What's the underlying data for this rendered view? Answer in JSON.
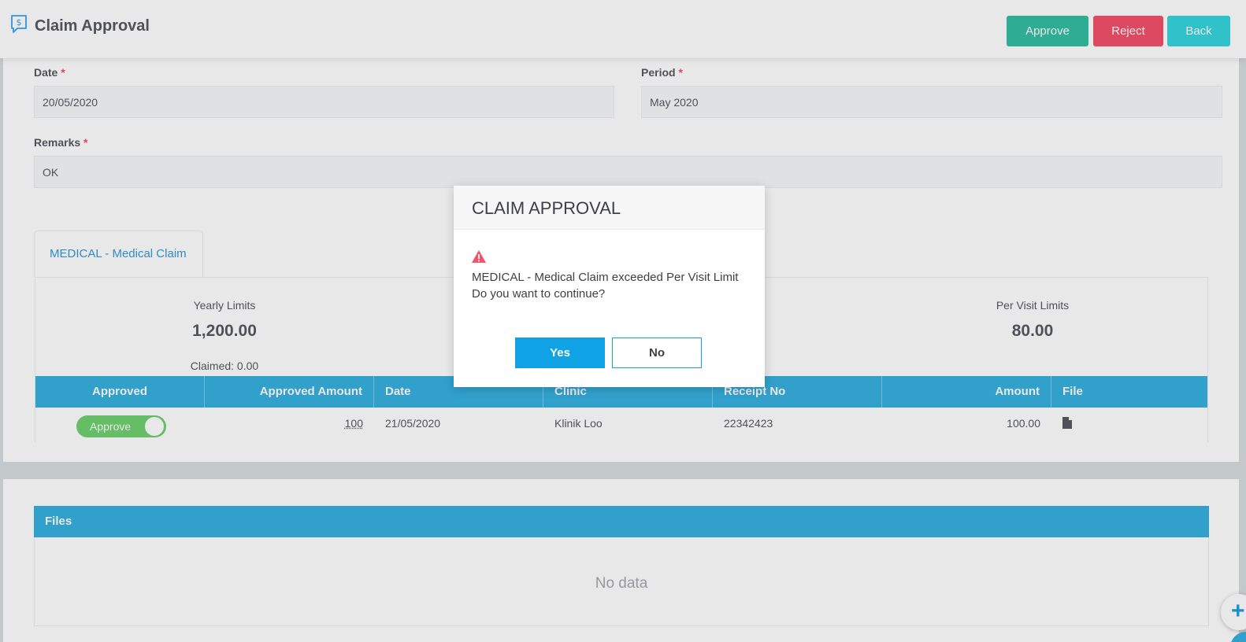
{
  "header": {
    "title": "Claim Approval",
    "approve_label": "Approve",
    "reject_label": "Reject",
    "back_label": "Back",
    "icon": "claim-dollar-icon"
  },
  "form": {
    "date_label": "Date",
    "date_value": "20/05/2020",
    "period_label": "Period",
    "period_value": "May 2020",
    "remarks_label": "Remarks",
    "remarks_value": "OK",
    "required_mark": "*"
  },
  "tab": {
    "label": "MEDICAL - Medical Claim"
  },
  "limits": {
    "yearly_label": "Yearly Limits",
    "yearly_value": "1,200.00",
    "claimed_text": "Claimed: 0.00",
    "per_visit_label": "Per Visit Limits",
    "per_visit_value": "80.00"
  },
  "table": {
    "columns": [
      "Approved",
      "Approved Amount",
      "Date",
      "Clinic",
      "Receipt No",
      "Amount",
      "File"
    ],
    "rows": [
      {
        "approved": "Approve",
        "approved_amount": "100",
        "date": "21/05/2020",
        "clinic": "Klinik Loo",
        "receipt_no": "22342423",
        "amount": "100.00",
        "file_icon": "file-icon"
      }
    ]
  },
  "files": {
    "title": "Files",
    "empty_text": "No data"
  },
  "modal": {
    "title": "CLAIM APPROVAL",
    "icon": "warning-icon",
    "message_line1": "MEDICAL - Medical Claim exceeded Per Visit Limit",
    "message_line2": "Do you want to continue?",
    "yes_label": "Yes",
    "no_label": "No"
  },
  "fab": {
    "label": "+"
  },
  "colors": {
    "approve": "#34bfa3",
    "reject": "#f4516c",
    "back": "#36d6dd",
    "table_header": "#36b0e0",
    "modal_yes": "#0fa3e6",
    "warning": "#f4516c"
  }
}
